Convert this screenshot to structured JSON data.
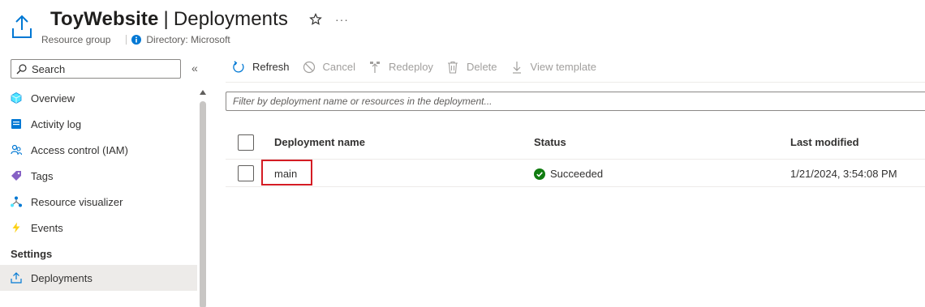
{
  "header": {
    "resource_name": "ToyWebsite",
    "separator": "|",
    "page_name": "Deployments",
    "more_label": "···",
    "resource_type": "Resource group",
    "directory": "Directory: Microsoft"
  },
  "sidebar": {
    "search_placeholder": "Search",
    "collapse_glyph": "«",
    "items": [
      {
        "label": "Overview",
        "icon": "overview-icon"
      },
      {
        "label": "Activity log",
        "icon": "activity-log-icon"
      },
      {
        "label": "Access control (IAM)",
        "icon": "people-icon"
      },
      {
        "label": "Tags",
        "icon": "tag-icon"
      },
      {
        "label": "Resource visualizer",
        "icon": "visualizer-icon"
      },
      {
        "label": "Events",
        "icon": "lightning-icon"
      }
    ],
    "section_settings": "Settings",
    "settings_items": [
      {
        "label": "Deployments",
        "icon": "deploy-icon",
        "selected": true
      }
    ]
  },
  "toolbar": {
    "refresh": "Refresh",
    "cancel": "Cancel",
    "redeploy": "Redeploy",
    "delete": "Delete",
    "view_template": "View template"
  },
  "filter": {
    "placeholder": "Filter by deployment name or resources in the deployment..."
  },
  "table": {
    "columns": [
      "Deployment name",
      "Status",
      "Last modified"
    ],
    "rows": [
      {
        "name": "main",
        "status": "Succeeded",
        "last_modified": "1/21/2024, 3:54:08 PM"
      }
    ]
  },
  "colors": {
    "link": "#0067b8",
    "success": "#107c10",
    "highlight": "#d41c24",
    "accent": "#0078d4"
  }
}
